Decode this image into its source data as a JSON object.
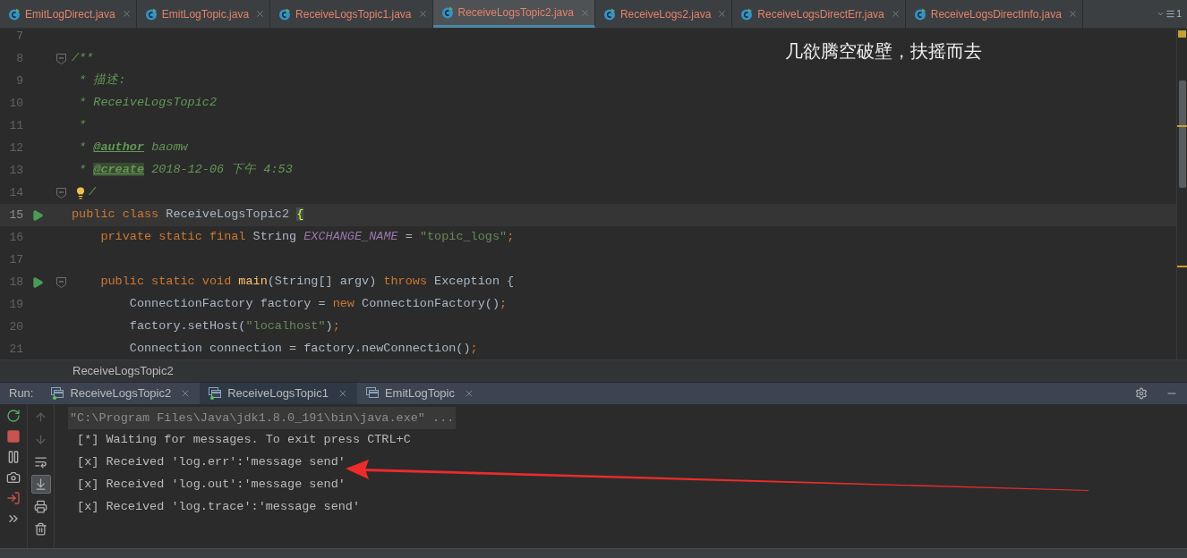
{
  "editor_tabs": [
    {
      "label": "EmitLogDirect.java",
      "selected": false
    },
    {
      "label": "EmitLogTopic.java",
      "selected": false
    },
    {
      "label": "ReceiveLogsTopic1.java",
      "selected": false
    },
    {
      "label": "ReceiveLogsTopic2.java",
      "selected": true
    },
    {
      "label": "ReceiveLogs2.java",
      "selected": false
    },
    {
      "label": "ReceiveLogsDirectErr.java",
      "selected": false
    },
    {
      "label": "ReceiveLogsDirectInfo.java",
      "selected": false
    }
  ],
  "tab_overflow_count": "1",
  "editor": {
    "overlay_text": "几欲腾空破壁，扶摇而去",
    "lines": [
      {
        "number": "7",
        "run": false,
        "fold": false,
        "bulb": false,
        "current": false
      },
      {
        "number": "8",
        "run": false,
        "fold": true,
        "bulb": false,
        "current": false,
        "tokens": [
          {
            "kind": "doc",
            "text": "/**"
          }
        ]
      },
      {
        "number": "9",
        "run": false,
        "fold": false,
        "bulb": false,
        "current": false,
        "tokens": [
          {
            "kind": "doc",
            "text": " * 描述:"
          }
        ]
      },
      {
        "number": "10",
        "run": false,
        "fold": false,
        "bulb": false,
        "current": false,
        "tokens": [
          {
            "kind": "doc",
            "text": " * ReceiveLogsTopic2"
          }
        ]
      },
      {
        "number": "11",
        "run": false,
        "fold": false,
        "bulb": false,
        "current": false,
        "tokens": [
          {
            "kind": "doc",
            "text": " *"
          }
        ]
      },
      {
        "number": "12",
        "run": false,
        "fold": false,
        "bulb": false,
        "current": false,
        "tokens": [
          {
            "kind": "doc",
            "text": " * "
          },
          {
            "kind": "tag",
            "text": "@author"
          },
          {
            "kind": "doc",
            "text": " baomw"
          }
        ]
      },
      {
        "number": "13",
        "run": false,
        "fold": false,
        "bulb": false,
        "current": false,
        "tokens": [
          {
            "kind": "doc",
            "text": " * "
          },
          {
            "kind": "tag_marked",
            "text": "@create"
          },
          {
            "kind": "doc",
            "text": " 2018-12-06 下午 4:53"
          }
        ]
      },
      {
        "number": "14",
        "run": false,
        "fold": true,
        "bulb": true,
        "current": false,
        "tokens": [
          {
            "kind": "doc",
            "text": "/"
          }
        ]
      },
      {
        "number": "15",
        "run": true,
        "fold": false,
        "bulb": false,
        "current": true,
        "tokens": [
          {
            "kind": "keyword",
            "text": "public class "
          },
          {
            "kind": "plain",
            "text": "ReceiveLogsTopic2 "
          },
          {
            "kind": "brace",
            "text": "{"
          }
        ]
      },
      {
        "number": "16",
        "run": false,
        "fold": false,
        "bulb": false,
        "current": false,
        "tokens": [
          {
            "kind": "keyword",
            "text": "    private static final "
          },
          {
            "kind": "plain",
            "text": "String "
          },
          {
            "kind": "constant",
            "text": "EXCHANGE_NAME"
          },
          {
            "kind": "plain",
            "text": " = "
          },
          {
            "kind": "string",
            "text": "\"topic_logs\""
          },
          {
            "kind": "keyword",
            "text": ";"
          }
        ]
      },
      {
        "number": "17",
        "run": false,
        "fold": false,
        "bulb": false,
        "current": false
      },
      {
        "number": "18",
        "run": true,
        "fold": true,
        "bulb": false,
        "current": false,
        "tokens": [
          {
            "kind": "keyword",
            "text": "    public static void "
          },
          {
            "kind": "method",
            "text": "main"
          },
          {
            "kind": "plain",
            "text": "(String[] argv) "
          },
          {
            "kind": "keyword",
            "text": "throws "
          },
          {
            "kind": "plain",
            "text": "Exception {"
          }
        ]
      },
      {
        "number": "19",
        "run": false,
        "fold": false,
        "bulb": false,
        "current": false,
        "tokens": [
          {
            "kind": "plain",
            "text": "        ConnectionFactory factory = "
          },
          {
            "kind": "keyword",
            "text": "new "
          },
          {
            "kind": "plain",
            "text": "ConnectionFactory()"
          },
          {
            "kind": "keyword",
            "text": ";"
          }
        ]
      },
      {
        "number": "20",
        "run": false,
        "fold": false,
        "bulb": false,
        "current": false,
        "tokens": [
          {
            "kind": "plain",
            "text": "        factory.setHost("
          },
          {
            "kind": "string",
            "text": "\"localhost\""
          },
          {
            "kind": "plain",
            "text": ")"
          },
          {
            "kind": "keyword",
            "text": ";"
          }
        ]
      },
      {
        "number": "21",
        "run": false,
        "fold": false,
        "bulb": false,
        "current": false,
        "tokens": [
          {
            "kind": "plain",
            "text": "        Connection connection = factory.newConnection()"
          },
          {
            "kind": "keyword",
            "text": ";"
          }
        ]
      }
    ]
  },
  "breadcrumb": "ReceiveLogsTopic2",
  "run_panel": {
    "label": "Run:",
    "tabs": [
      {
        "label": "ReceiveLogsTopic2",
        "selected": false,
        "running": true
      },
      {
        "label": "ReceiveLogsTopic1",
        "selected": true,
        "running": true
      },
      {
        "label": "EmitLogTopic",
        "selected": false,
        "running": false
      }
    ],
    "toolbar_left": [
      {
        "kind": "rerun"
      },
      {
        "kind": "stop"
      },
      {
        "kind": "pause"
      },
      {
        "kind": "snapshot"
      },
      {
        "kind": "exit"
      },
      {
        "kind": "more"
      }
    ],
    "toolbar_right": [
      {
        "kind": "up",
        "disabled": true,
        "toggled": false
      },
      {
        "kind": "down",
        "disabled": true,
        "toggled": false
      },
      {
        "kind": "wrap",
        "disabled": false,
        "toggled": false
      },
      {
        "kind": "scroll_end",
        "disabled": false,
        "toggled": true
      },
      {
        "kind": "print",
        "disabled": false,
        "toggled": false
      },
      {
        "kind": "clear",
        "disabled": false,
        "toggled": false
      }
    ],
    "console": [
      {
        "kind": "command",
        "text": "\"C:\\Program Files\\Java\\jdk1.8.0_191\\bin\\java.exe\" ..."
      },
      {
        "kind": "output",
        "text": " [*] Waiting for messages. To exit press CTRL+C"
      },
      {
        "kind": "output",
        "text": " [x] Received 'log.err':'message send'"
      },
      {
        "kind": "output",
        "text": " [x] Received 'log.out':'message send'"
      },
      {
        "kind": "output",
        "text": " [x] Received 'log.trace':'message send'"
      }
    ]
  }
}
